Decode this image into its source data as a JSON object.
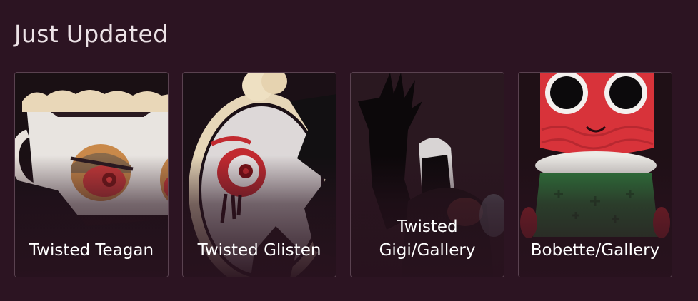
{
  "section": {
    "title": "Just Updated"
  },
  "cards": [
    {
      "label_lines": [
        "Twisted Teagan"
      ],
      "icon": "twisted-teagan-thumbnail"
    },
    {
      "label_lines": [
        "Twisted Glisten"
      ],
      "icon": "twisted-glisten-thumbnail"
    },
    {
      "label_lines": [
        "Twisted",
        "Gigi/Gallery"
      ],
      "icon": "twisted-gigi-thumbnail"
    },
    {
      "label_lines": [
        "Bobette/Gallery"
      ],
      "icon": "bobette-thumbnail"
    }
  ],
  "colors": {
    "background": "#2c1422",
    "card_border": "#5a4250",
    "title_text": "#ece2e6",
    "label_text": "#ffffff"
  }
}
